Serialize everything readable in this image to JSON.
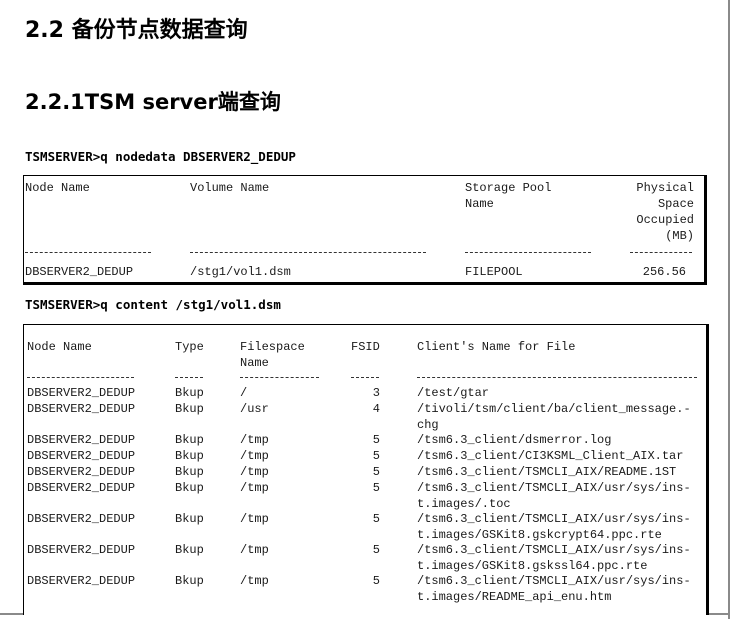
{
  "section_heading": "2.2 备份节点数据查询",
  "subsection_heading": "2.2.1TSM  server端查询",
  "commands": {
    "nodedata": "TSMSERVER>q nodedata DBSERVER2_DEDUP",
    "content": "TSMSERVER>q content /stg1/vol1.dsm"
  },
  "nodedata_table": {
    "headers": {
      "node_name": "Node Name",
      "volume_name": "Volume Name",
      "storage_pool": "Storage Pool\nName",
      "physical_space": "Physical\nSpace\nOccupied\n(MB)"
    },
    "row": {
      "node_name": "DBSERVER2_DEDUP",
      "volume_name": "/stg1/vol1.dsm",
      "storage_pool": "FILEPOOL",
      "physical_space": "256.56"
    }
  },
  "content_table": {
    "headers": {
      "node_name": "Node Name",
      "type": "Type",
      "filespace": "Filespace\nName",
      "fsid": "FSID",
      "client_name": "Client's Name for File"
    },
    "rows": [
      {
        "node": "DBSERVER2_DEDUP",
        "type": "Bkup",
        "filespace": "/",
        "fsid": "3",
        "file": "/test/gtar"
      },
      {
        "node": "DBSERVER2_DEDUP",
        "type": "Bkup",
        "filespace": "/usr",
        "fsid": "4",
        "file": "/tivoli/tsm/client/ba/client_message.-\nchg"
      },
      {
        "node": "DBSERVER2_DEDUP",
        "type": "Bkup",
        "filespace": "/tmp",
        "fsid": "5",
        "file": "/tsm6.3_client/dsmerror.log"
      },
      {
        "node": "DBSERVER2_DEDUP",
        "type": "Bkup",
        "filespace": "/tmp",
        "fsid": "5",
        "file": "/tsm6.3_client/CI3KSML_Client_AIX.tar"
      },
      {
        "node": "DBSERVER2_DEDUP",
        "type": "Bkup",
        "filespace": "/tmp",
        "fsid": "5",
        "file": "/tsm6.3_client/TSMCLI_AIX/README.1ST"
      },
      {
        "node": "DBSERVER2_DEDUP",
        "type": "Bkup",
        "filespace": "/tmp",
        "fsid": "5",
        "file": "/tsm6.3_client/TSMCLI_AIX/usr/sys/ins-\nt.images/.toc"
      },
      {
        "node": "DBSERVER2_DEDUP",
        "type": "Bkup",
        "filespace": "/tmp",
        "fsid": "5",
        "file": "/tsm6.3_client/TSMCLI_AIX/usr/sys/ins-\nt.images/GSKit8.gskcrypt64.ppc.rte"
      },
      {
        "node": "DBSERVER2_DEDUP",
        "type": "Bkup",
        "filespace": "/tmp",
        "fsid": "5",
        "file": "/tsm6.3_client/TSMCLI_AIX/usr/sys/ins-\nt.images/GSKit8.gskssl64.ppc.rte"
      },
      {
        "node": "DBSERVER2_DEDUP",
        "type": "Bkup",
        "filespace": "/tmp",
        "fsid": "5",
        "file": "/tsm6.3_client/TSMCLI_AIX/usr/sys/ins-\nt.images/README_api_enu.htm"
      }
    ]
  }
}
